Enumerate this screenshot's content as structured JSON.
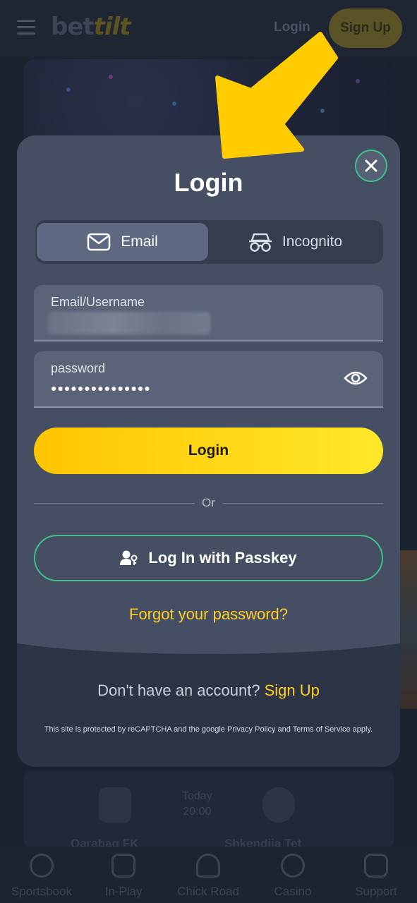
{
  "header": {
    "brand_part1": "bet",
    "brand_part2": "tilt",
    "login_label": "Login",
    "signup_label": "Sign Up"
  },
  "match": {
    "time_day": "Today",
    "time_hour": "20:00",
    "team_home": "Qarabag FK",
    "team_away": "Shkendija Tet"
  },
  "bottom_nav": [
    {
      "label": "Sportsbook",
      "icon": "basketball-icon"
    },
    {
      "label": "In-Play",
      "icon": "play-icon"
    },
    {
      "label": "Chick Road",
      "icon": "chicken-icon"
    },
    {
      "label": "Casino",
      "icon": "cherries-icon"
    },
    {
      "label": "Support",
      "icon": "chat-icon"
    }
  ],
  "modal": {
    "title": "Login",
    "close_icon": "close-icon",
    "tabs": [
      {
        "label": "Email",
        "icon": "envelope-icon",
        "active": true
      },
      {
        "label": "Incognito",
        "icon": "incognito-icon",
        "active": false
      }
    ],
    "email_field": {
      "label": "Email/Username",
      "value": ""
    },
    "password_field": {
      "label": "password",
      "value": "●●●●●●●●●●●●●●●"
    },
    "login_button": "Login",
    "or_text": "Or",
    "passkey_button": "Log In with Passkey",
    "forgot_password": "Forgot your password?",
    "no_account_text": "Don't have an account?",
    "signup_link": "Sign Up",
    "recaptcha_notice": "This site is protected by reCAPTCHA and the google Privacy Policy and Terms of Service apply."
  },
  "colors": {
    "accent_yellow": "#ffce1f",
    "accent_green": "#3fbf8f",
    "modal_bg": "#454e62"
  }
}
